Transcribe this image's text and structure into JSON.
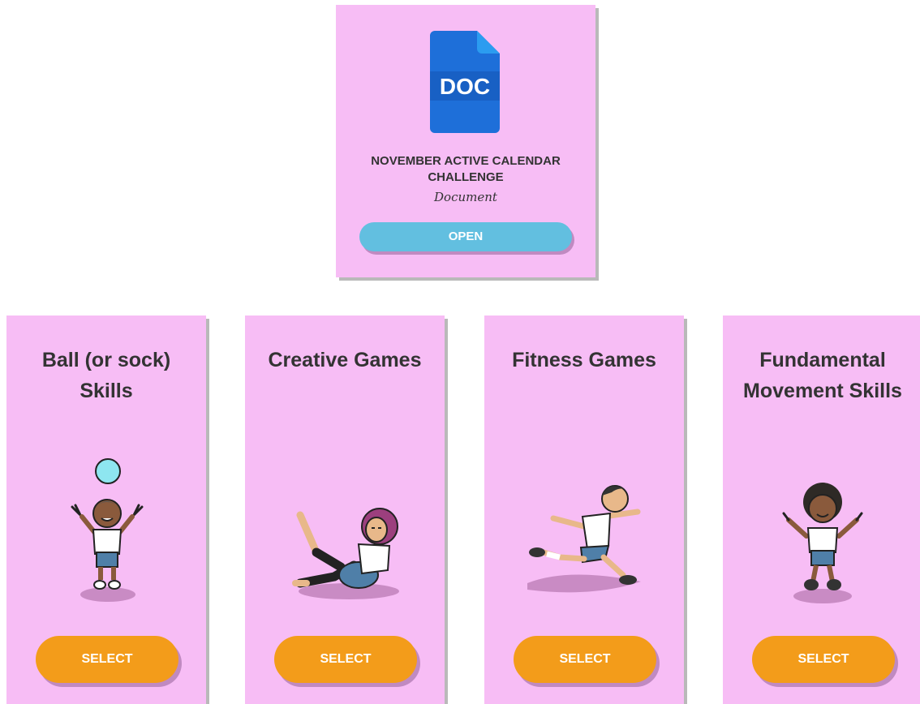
{
  "document": {
    "icon_label": "DOC",
    "title": "NOVEMBER ACTIVE CALENDAR CHALLENGE",
    "type": "Document",
    "open_label": "OPEN"
  },
  "cards": [
    {
      "title": "Ball (or sock) Skills",
      "button": "SELECT",
      "illustration": "child-with-ball-illustration"
    },
    {
      "title": "Creative Games",
      "button": "SELECT",
      "illustration": "girl-stretching-illustration"
    },
    {
      "title": "Fitness Games",
      "button": "SELECT",
      "illustration": "boy-running-illustration"
    },
    {
      "title": "Fundamental Movement Skills",
      "button": "SELECT",
      "illustration": "child-jumping-illustration"
    }
  ],
  "colors": {
    "card_bg": "#f7bdf5",
    "open_button": "#62bfe0",
    "select_button": "#f39c1a",
    "doc_icon": "#1e6fd9"
  }
}
